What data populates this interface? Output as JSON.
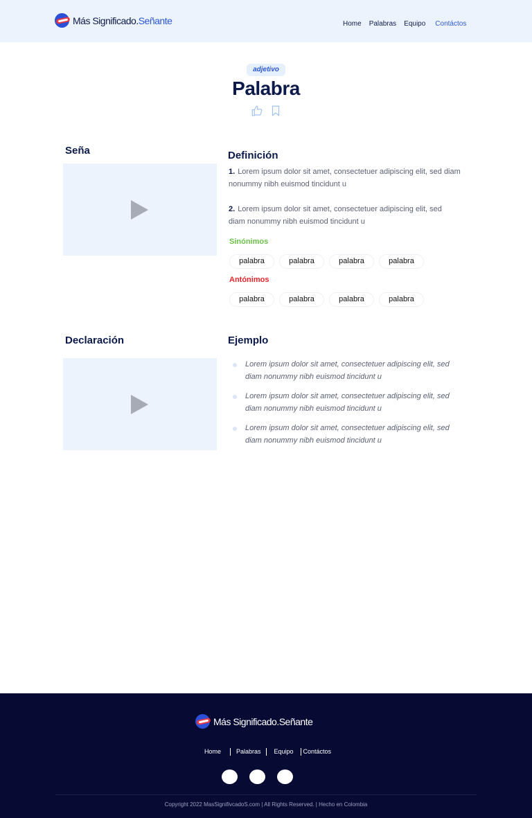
{
  "header": {
    "logo_part1": "Más Significado.",
    "logo_part2": "Señante",
    "nav": [
      "Home",
      "Palabras",
      "Equipo",
      "Contáctos"
    ]
  },
  "word": {
    "badge": "adjetivo",
    "title": "Palabra",
    "like_icon": "thumbs-up-icon",
    "bookmark_icon": "bookmark-icon"
  },
  "sena": {
    "title": "Seña",
    "video_icon": "play-icon"
  },
  "definicion": {
    "title": "Definición",
    "items": [
      {
        "num": "1.",
        "text": "Lorem ipsum dolor sit amet, consectetuer adipiscing elit, sed diam nonummy nibh euismod tincidunt u"
      },
      {
        "num": "2.",
        "text": "Lorem ipsum dolor sit amet, consectetuer adipiscing elit, sed diam nonummy nibh euismod tincidunt u"
      }
    ],
    "sinonimos_label": "Sinónimos",
    "sinonimos": [
      "palabra",
      "palabra",
      "palabra",
      "palabra"
    ],
    "antonimos_label": "Antónimos",
    "antonimos": [
      "palabra",
      "palabra",
      "palabra",
      "palabra"
    ],
    "sinonimos_color": "#6cc04a",
    "antonimos_color": "#e5242b"
  },
  "declaracion": {
    "title": "Declaración",
    "video_icon": "play-icon"
  },
  "ejemplo": {
    "title": "Ejemplo",
    "items": [
      "Lorem ipsum dolor sit amet, consectetuer adipiscing elit, sed diam nonummy nibh euismod tincidunt u",
      "Lorem ipsum dolor sit amet, consectetuer adipiscing elit, sed diam nonummy nibh euismod tincidunt u",
      "Lorem ipsum dolor sit amet, consectetuer adipiscing elit, sed diam nonummy nibh euismod tincidunt u"
    ]
  },
  "footer": {
    "logo_part1": "Más Significado.",
    "logo_part2": "Señante",
    "nav": [
      "Home",
      "Palabras",
      "Equipo",
      "Contáctos"
    ],
    "social_icons": [
      "social-icon-1",
      "social-icon-2",
      "social-icon-3"
    ],
    "copyright": "Copyright 2022 MasSignifivcadoS.com | All Rights Reserved.  | Hecho en Colombia"
  },
  "colors": {
    "accent": "#2b57d6",
    "navy": "#0b1a4a",
    "footer_bg": "#070b33",
    "light_bg": "#edf3fd"
  }
}
